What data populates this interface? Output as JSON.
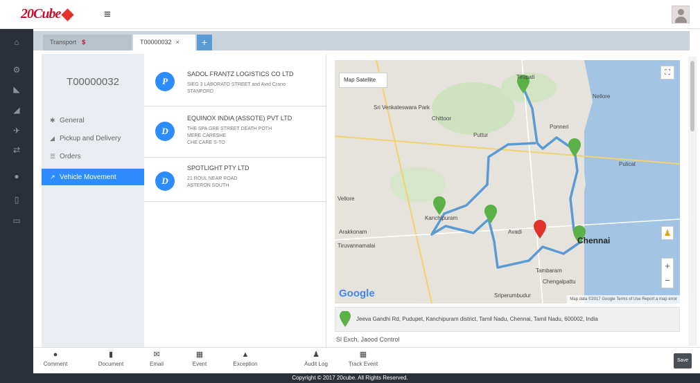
{
  "header": {
    "logo": "20Cube",
    "menu_icon": "hamburger-icon",
    "avatar_icon": "user-icon"
  },
  "tabs": {
    "inactive_label": "Transport",
    "separator": "$",
    "active_label": "T00000032",
    "close": "×",
    "add": "+"
  },
  "shipment": {
    "number": "T00000032"
  },
  "nav": {
    "items": [
      {
        "icon": "asterisk-icon",
        "glyph": "✱",
        "label": "General"
      },
      {
        "icon": "truck-icon",
        "glyph": "◢",
        "label": "Pickup and Delivery"
      },
      {
        "icon": "list-icon",
        "glyph": "☰",
        "label": "Orders"
      },
      {
        "icon": "chart-icon",
        "glyph": "↗",
        "label": "Vehicle Movement",
        "active": true
      }
    ]
  },
  "stops": [
    {
      "badge": "P",
      "name": "SADOL FRANTZ LOGISTICS CO LTD",
      "address": [
        "SIEG 3 LABORATO STREET and Avrd Crano",
        "STANFORD"
      ]
    },
    {
      "badge": "D",
      "name": "EQUINOX INDIA (ASSOTE) PVT LTD",
      "address": [
        "THE SPA GRE STREET DEATH POTH",
        "MERE CARESHE",
        "CHE CARE S-TO"
      ]
    },
    {
      "badge": "D",
      "name": "SPOTLIGHT PTY LTD",
      "address": [
        "21 ROUL NEAR ROAD",
        "ASTERON SOUTH"
      ]
    }
  ],
  "map": {
    "maptype_label": "Map  Satellite",
    "fullscreen_icon": "⛶",
    "zoom_in": "+",
    "zoom_out": "−",
    "provider": "Google",
    "terms": "Map data ©2017 Google  Terms of Use  Report a map error",
    "labels": [
      "Tirupati",
      "Sri Venkateswara Park",
      "Chittoor",
      "Nellore",
      "Puttur",
      "Ponneri",
      "Vellore",
      "Kanchipuram",
      "Avadi",
      "Chennai",
      "Chengalpattu",
      "Tiruvannamalai",
      "Arakkonam",
      "Sriperumbudur",
      "Tambaram",
      "Pulicat"
    ],
    "route_color": "#5b9bd5",
    "pin_color": "#5bb047",
    "current_pin_color": "#e0322b"
  },
  "address_bar": {
    "text": "Jeeva Gandhi Rd, Pudupet, Kanchipuram district, Tamil Nadu, Chennai, Tamil Nadu, 600002, India"
  },
  "geofence": {
    "text": "Sl Exch, Jaood Control"
  },
  "footer": {
    "buttons": [
      {
        "icon": "comment-icon",
        "glyph": "●",
        "label": "Comment"
      },
      {
        "icon": "document-icon",
        "glyph": "▮",
        "label": "Document"
      },
      {
        "icon": "email-icon",
        "glyph": "✉",
        "label": "Email"
      },
      {
        "icon": "event-icon",
        "glyph": "▦",
        "label": "Event"
      },
      {
        "icon": "exception-icon",
        "glyph": "▲",
        "label": "Exception"
      },
      {
        "icon": "audit-log-icon",
        "glyph": "♟",
        "label": "Audit Log"
      },
      {
        "icon": "track-event-icon",
        "glyph": "▦",
        "label": "Track Event"
      }
    ],
    "save_label": "Save"
  },
  "copyright": "Copyright © 2017 20cube. All Rights Reserved."
}
